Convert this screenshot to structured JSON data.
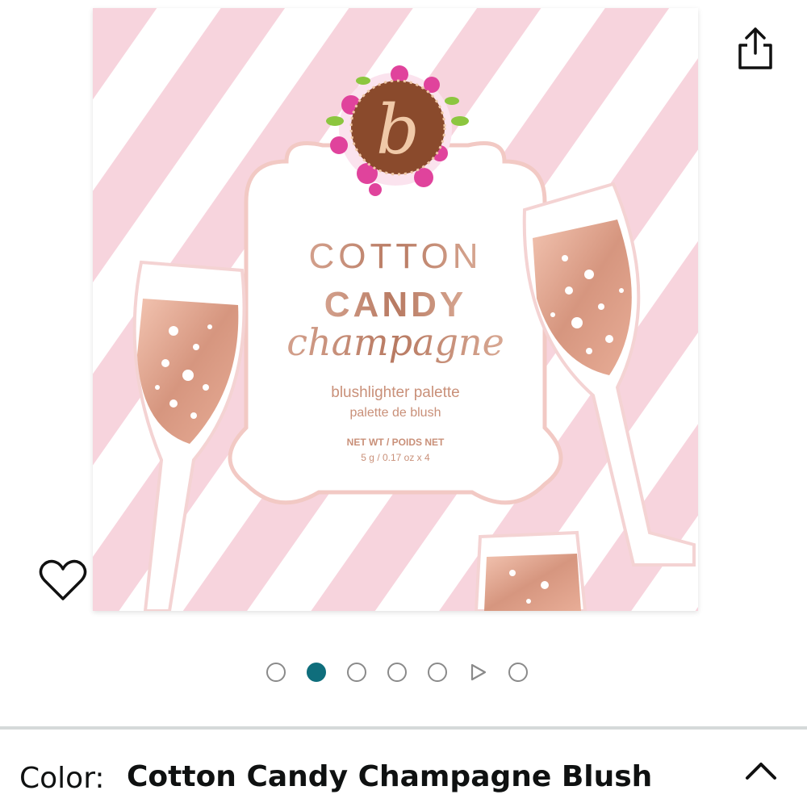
{
  "product_image": {
    "brand_mark": "b",
    "line1": "COTTON",
    "line2": "CANDY",
    "line3": "champagne",
    "subtitle_en": "blushlighter palette",
    "subtitle_fr": "palette de blush",
    "net_label": "NET WT / POIDS NET",
    "net_value": "5 g / 0.17 oz x 4"
  },
  "icons": {
    "share": "share-icon",
    "favorite": "heart-icon",
    "collapse": "chevron-up-icon"
  },
  "carousel": {
    "total_items": 7,
    "active_index": 1,
    "video_index": 5
  },
  "variation": {
    "label": "Color:",
    "value": "Cotton Candy Champagne Blush"
  },
  "colors": {
    "accent": "#0f6e7c",
    "stripe_pink": "#f7cfd9",
    "rose_gold": "#c98b76"
  }
}
